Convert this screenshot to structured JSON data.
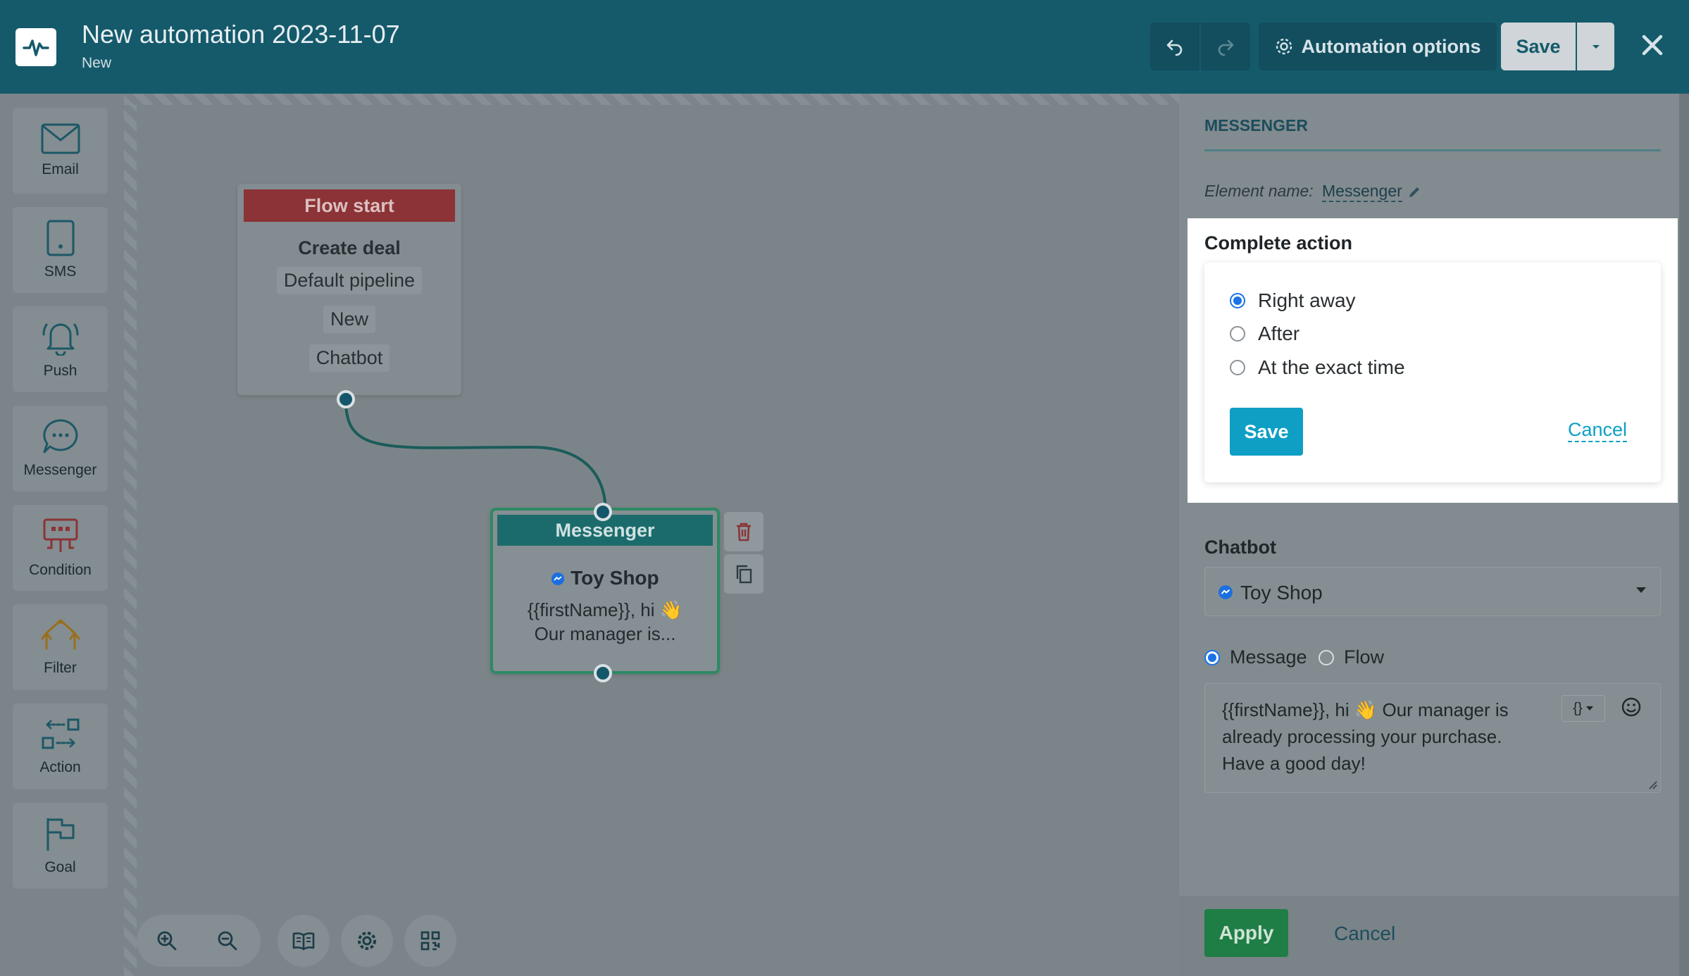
{
  "header": {
    "title": "New automation 2023-11-07",
    "status": "New",
    "options_label": "Automation options",
    "save_label": "Save"
  },
  "toolbox": [
    {
      "label": "Email",
      "icon": "envelope-icon"
    },
    {
      "label": "SMS",
      "icon": "phone-icon"
    },
    {
      "label": "Push",
      "icon": "bell-icon"
    },
    {
      "label": "Messenger",
      "icon": "chat-bubble-icon"
    },
    {
      "label": "Condition",
      "icon": "condition-icon"
    },
    {
      "label": "Filter",
      "icon": "filter-icon"
    },
    {
      "label": "Action",
      "icon": "action-icon"
    },
    {
      "label": "Goal",
      "icon": "flag-icon"
    }
  ],
  "flow_start": {
    "title": "Flow start",
    "action": "Create deal",
    "tags": [
      "Default pipeline",
      "New",
      "Chatbot"
    ]
  },
  "messenger_node": {
    "title": "Messenger",
    "shop": "Toy Shop",
    "line1": "{{firstName}}, hi 👋",
    "line2": "Our manager is..."
  },
  "panel": {
    "tab": "MESSENGER",
    "element_name_label": "Element name:",
    "element_name_value": "Messenger",
    "complete_action": {
      "title": "Complete action",
      "options": [
        "Right away",
        "After",
        "At the exact time"
      ],
      "selected": "Right away",
      "save_label": "Save",
      "cancel_label": "Cancel"
    },
    "chatbot": {
      "label": "Chatbot",
      "selected": "Toy Shop"
    },
    "mode": {
      "message_label": "Message",
      "flow_label": "Flow",
      "selected": "Message"
    },
    "message_text": "{{firstName}}, hi 👋 Our manager is already processing your purchase. Have a good day!",
    "var_label": "{}",
    "apply_label": "Apply",
    "cancel_label": "Cancel"
  },
  "colors": {
    "header": "#145a6b",
    "accent": "#0f9fc4",
    "apply": "#1f7d46",
    "flow_start": "#8b3336",
    "messenger_head": "#1c6b6c",
    "node_border": "#2c8a64",
    "selected_radio": "#1a73e8"
  }
}
